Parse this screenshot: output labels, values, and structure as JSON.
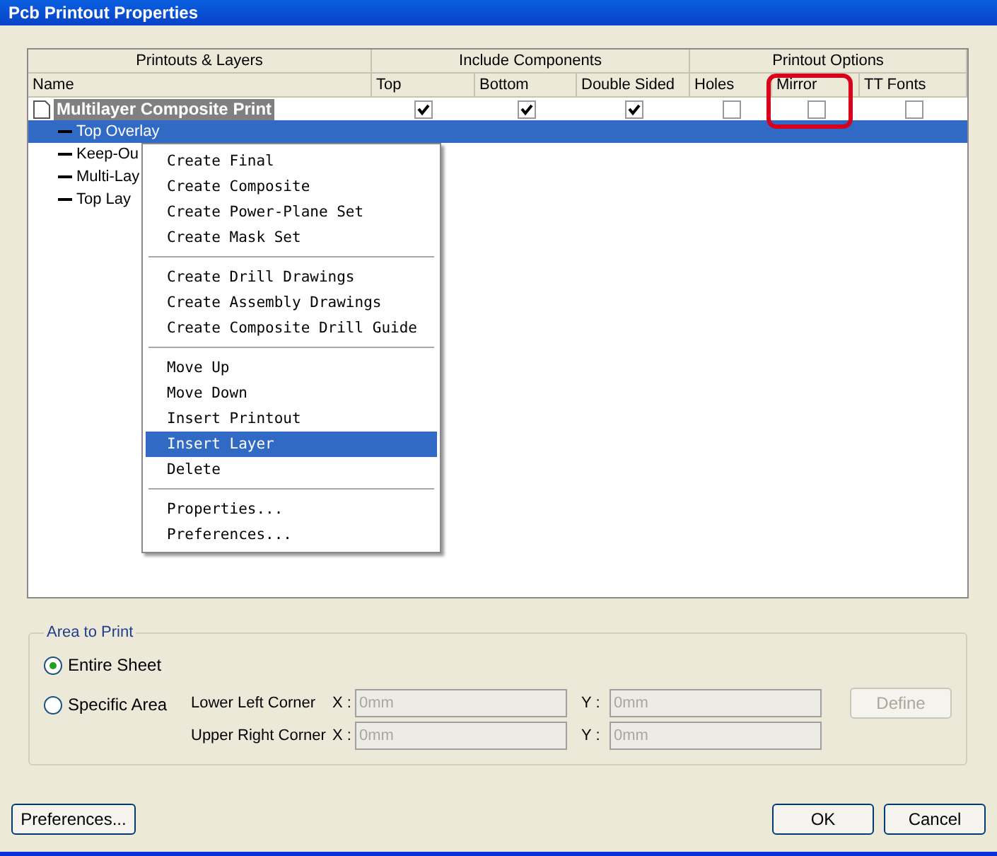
{
  "window": {
    "title": "Pcb Printout Properties"
  },
  "grid": {
    "groups": [
      {
        "label": "Printouts & Layers"
      },
      {
        "label": "Include Components"
      },
      {
        "label": "Printout Options"
      }
    ],
    "columns": [
      "Name",
      "Top",
      "Bottom",
      "Double Sided",
      "Holes",
      "Mirror",
      "TT Fonts"
    ],
    "rows": [
      {
        "name": "Multilayer Composite Print",
        "selected": false,
        "checks": [
          true,
          true,
          true,
          false,
          false,
          false
        ],
        "children": [
          {
            "name": "Top Overlay",
            "selected": true
          },
          {
            "name": "Keep-Ou",
            "selected": false
          },
          {
            "name": "Multi-Lay",
            "selected": false
          },
          {
            "name": "Top Lay",
            "selected": false
          }
        ]
      }
    ]
  },
  "context_menu": {
    "sections": [
      [
        {
          "label": "Create Final",
          "selected": false
        },
        {
          "label": "Create Composite",
          "selected": false
        },
        {
          "label": "Create Power-Plane Set",
          "selected": false
        },
        {
          "label": "Create Mask Set",
          "selected": false
        }
      ],
      [
        {
          "label": "Create Drill Drawings",
          "selected": false
        },
        {
          "label": "Create Assembly Drawings",
          "selected": false
        },
        {
          "label": "Create Composite Drill Guide",
          "selected": false
        }
      ],
      [
        {
          "label": "Move Up",
          "selected": false
        },
        {
          "label": "Move Down",
          "selected": false
        },
        {
          "label": "Insert Printout",
          "selected": false
        },
        {
          "label": "Insert Layer",
          "selected": true
        },
        {
          "label": "Delete",
          "selected": false
        }
      ],
      [
        {
          "label": "Properties...",
          "selected": false
        },
        {
          "label": "Preferences...",
          "selected": false
        }
      ]
    ]
  },
  "area_to_print": {
    "title": "Area to Print",
    "options": [
      {
        "label": "Entire Sheet",
        "selected": true
      },
      {
        "label": "Specific Area",
        "selected": false
      }
    ],
    "corners": [
      {
        "label": "Lower Left Corner",
        "x_label": "X :",
        "x_value": "0mm",
        "y_label": "Y :",
        "y_value": "0mm",
        "disabled": true
      },
      {
        "label": "Upper Right Corner",
        "x_label": "X :",
        "x_value": "0mm",
        "y_label": "Y :",
        "y_value": "0mm",
        "disabled": true
      }
    ],
    "define_button": {
      "label": "Define",
      "disabled": true
    }
  },
  "buttons": {
    "preferences": "Preferences...",
    "ok": "OK",
    "cancel": "Cancel"
  }
}
